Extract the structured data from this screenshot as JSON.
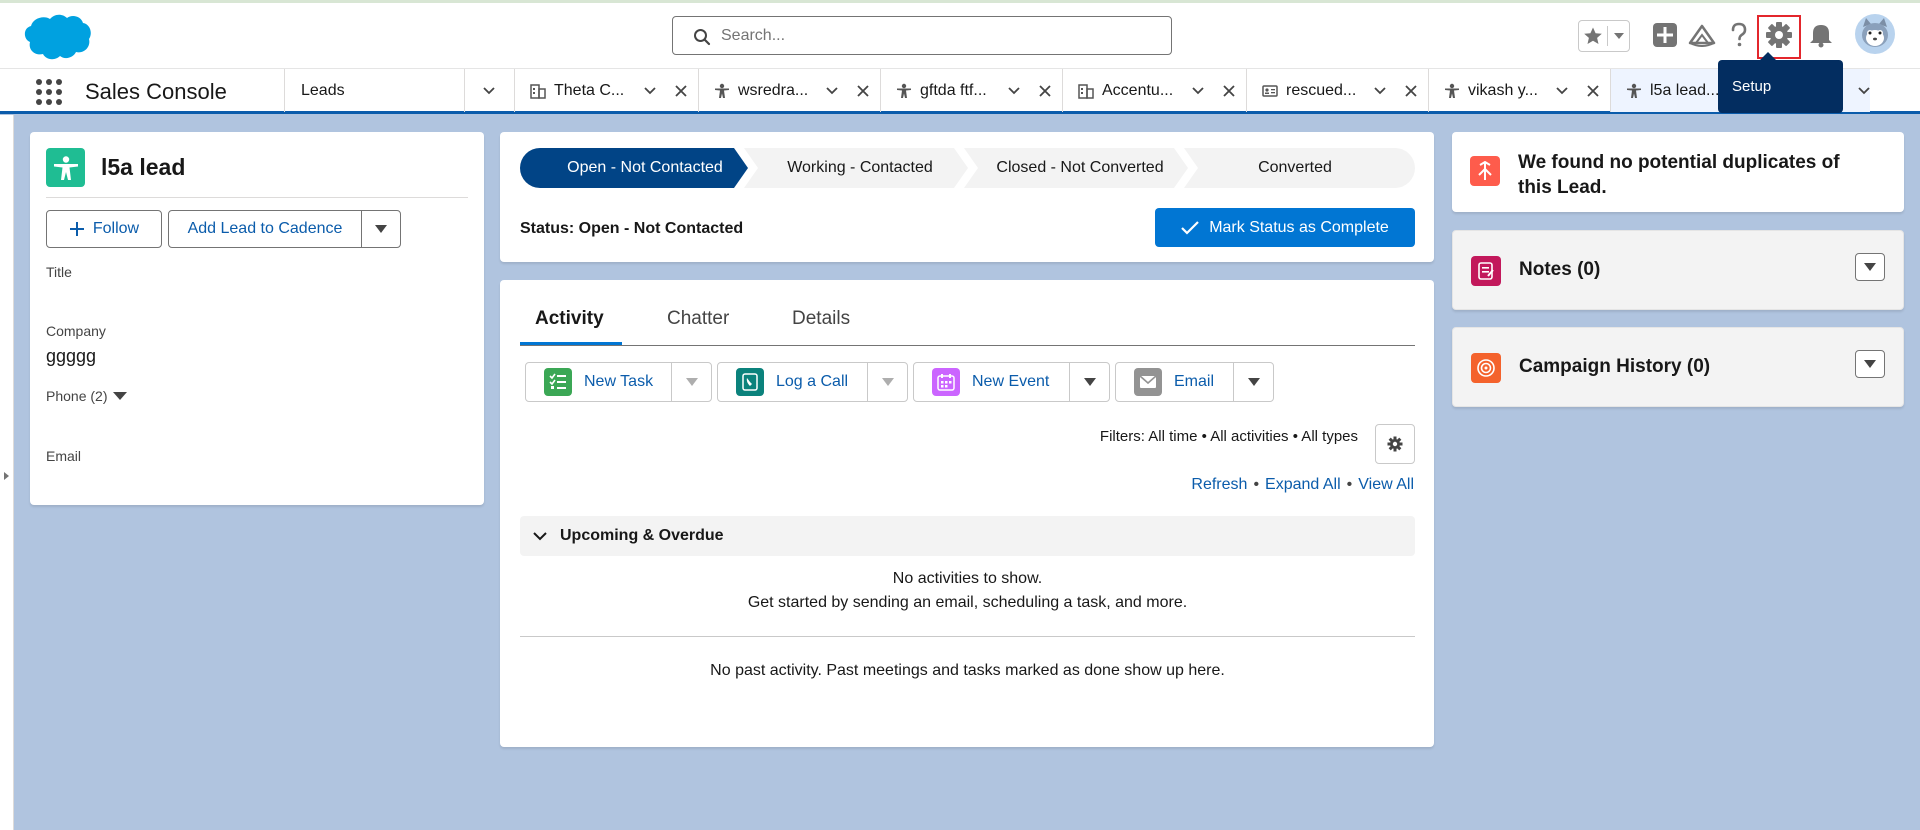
{
  "header": {
    "search_placeholder": "Search...",
    "tooltip": "Setup"
  },
  "nav": {
    "app_name": "Sales Console",
    "tabs": [
      {
        "label": "Leads",
        "icon": "none"
      },
      {
        "label": "Theta C...",
        "icon": "building-icon"
      },
      {
        "label": "wsredra...",
        "icon": "lead-icon"
      },
      {
        "label": "gftda ftf...",
        "icon": "lead-icon"
      },
      {
        "label": "Accentu...",
        "icon": "building-icon"
      },
      {
        "label": "rescued...",
        "icon": "contact-card-icon"
      },
      {
        "label": "vikash y...",
        "icon": "lead-icon"
      },
      {
        "label": "l5a lead...",
        "icon": "lead-icon"
      }
    ]
  },
  "lead": {
    "name": "l5a lead",
    "follow_label": "Follow",
    "cadence_label": "Add Lead to Cadence",
    "fields": {
      "title_label": "Title",
      "company_label": "Company",
      "company_value": "ggggg",
      "phone_label": "Phone (2)",
      "email_label": "Email"
    }
  },
  "path": {
    "stages": [
      "Open - Not Contacted",
      "Working - Contacted",
      "Closed - Not Converted",
      "Converted"
    ],
    "status_text": "Status: Open - Not Contacted",
    "mark_complete_label": "Mark Status as Complete"
  },
  "activity": {
    "tabs": [
      "Activity",
      "Chatter",
      "Details"
    ],
    "publishers": [
      "New Task",
      "Log a Call",
      "New Event",
      "Email"
    ],
    "filters_text": "Filters: All time • All activities • All types",
    "links": {
      "refresh": "Refresh",
      "expand_all": "Expand All",
      "view_all": "View All",
      "separator": "•"
    },
    "upcoming_title": "Upcoming & Overdue",
    "no_activities": "No activities to show.",
    "get_started": "Get started by sending an email, scheduling a task, and more.",
    "no_past": "No past activity. Past meetings and tasks marked as done show up here."
  },
  "right": {
    "duplicates_text": "We found no potential duplicates of this Lead.",
    "notes_title": "Notes (0)",
    "campaign_title": "Campaign History (0)"
  },
  "colors": {
    "brand_blue": "#0176d3",
    "path_active": "#014486",
    "page_bg": "#b0c4df",
    "lead_icon": "#1fbd93"
  }
}
